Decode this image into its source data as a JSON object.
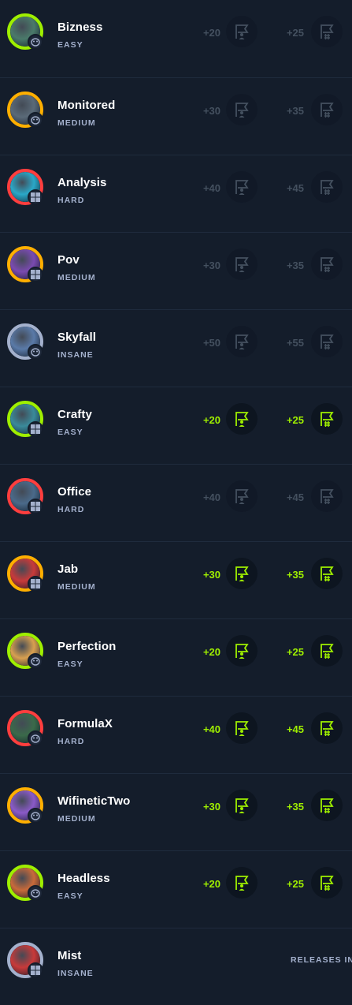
{
  "colors": {
    "easy": "#9fef00",
    "medium": "#ffaf00",
    "hard": "#ff3e3e",
    "insane": "#a4b1cd",
    "points_done": "#9fef00",
    "points_pending": "#44505f"
  },
  "machines": [
    {
      "name": "Bizness",
      "difficulty": "EASY",
      "level": "easy",
      "os": "linux",
      "user_points": "+20",
      "root_points": "+25",
      "owned": false,
      "avatar": "#4a7a6a"
    },
    {
      "name": "Monitored",
      "difficulty": "MEDIUM",
      "level": "medium",
      "os": "linux",
      "user_points": "+30",
      "root_points": "+35",
      "owned": false,
      "avatar": "#5a6a78"
    },
    {
      "name": "Analysis",
      "difficulty": "HARD",
      "level": "hard",
      "os": "windows",
      "user_points": "+40",
      "root_points": "+45",
      "owned": false,
      "avatar": "#2aa8c8"
    },
    {
      "name": "Pov",
      "difficulty": "MEDIUM",
      "level": "medium",
      "os": "windows",
      "user_points": "+30",
      "root_points": "+35",
      "owned": false,
      "avatar": "#7a4ab0"
    },
    {
      "name": "Skyfall",
      "difficulty": "INSANE",
      "level": "insane",
      "os": "linux",
      "user_points": "+50",
      "root_points": "+55",
      "owned": false,
      "avatar": "#5a7aa8"
    },
    {
      "name": "Crafty",
      "difficulty": "EASY",
      "level": "easy",
      "os": "windows",
      "user_points": "+20",
      "root_points": "+25",
      "owned": true,
      "avatar": "#3a8a9a"
    },
    {
      "name": "Office",
      "difficulty": "HARD",
      "level": "hard",
      "os": "windows",
      "user_points": "+40",
      "root_points": "+45",
      "owned": false,
      "avatar": "#4a6a8a"
    },
    {
      "name": "Jab",
      "difficulty": "MEDIUM",
      "level": "medium",
      "os": "windows",
      "user_points": "+30",
      "root_points": "+35",
      "owned": true,
      "avatar": "#c83a3a"
    },
    {
      "name": "Perfection",
      "difficulty": "EASY",
      "level": "easy",
      "os": "linux",
      "user_points": "+20",
      "root_points": "+25",
      "owned": true,
      "avatar": "#d8a050"
    },
    {
      "name": "FormulaX",
      "difficulty": "HARD",
      "level": "hard",
      "os": "linux",
      "user_points": "+40",
      "root_points": "+45",
      "owned": true,
      "avatar": "#3a6a4a"
    },
    {
      "name": "WifineticTwo",
      "difficulty": "MEDIUM",
      "level": "medium",
      "os": "linux",
      "user_points": "+30",
      "root_points": "+35",
      "owned": true,
      "avatar": "#8a5ac8"
    },
    {
      "name": "Headless",
      "difficulty": "EASY",
      "level": "easy",
      "os": "linux",
      "user_points": "+20",
      "root_points": "+25",
      "owned": true,
      "avatar": "#c86a3a"
    },
    {
      "name": "Mist",
      "difficulty": "INSANE",
      "level": "insane",
      "os": "windows",
      "release_text": "RELEASES IN",
      "avatar": "#c83a3a"
    }
  ]
}
